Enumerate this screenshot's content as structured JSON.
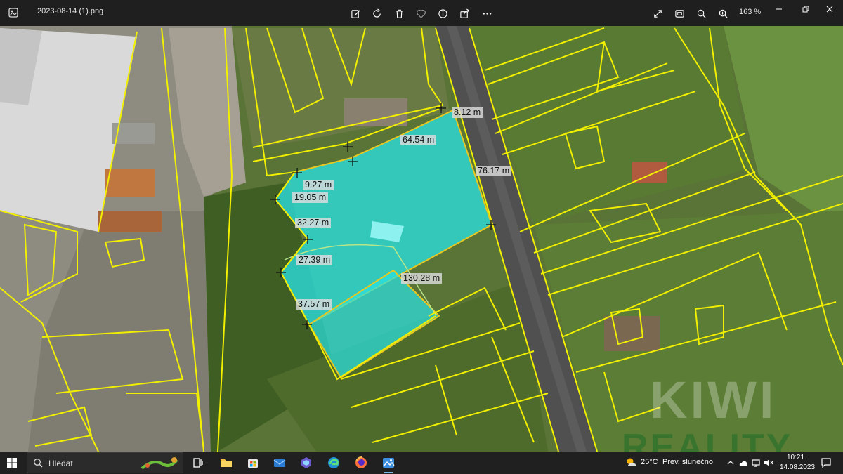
{
  "window": {
    "filename": "2023-08-14 (1).png",
    "zoom": "163 %"
  },
  "toolbar": {
    "items": [
      "edit-icon",
      "rotate-icon",
      "delete-icon",
      "favorite-icon",
      "info-icon",
      "share-icon",
      "more-icon"
    ]
  },
  "map": {
    "measurements": [
      "8.12 m",
      "64.54 m",
      "76.17 m",
      "9.27 m",
      "19.05 m",
      "32.27 m",
      "27.39 m",
      "130.28 m",
      "37.57 m"
    ],
    "colors": {
      "parcel_lines": "#f2f000",
      "plot_fill": "#29e0e0",
      "plot_outline": "#e8c820"
    }
  },
  "watermark": {
    "line1": "KIWI",
    "line2": "REALITY"
  },
  "taskbar": {
    "search_placeholder": "Hledat",
    "weather_temp": "25°C",
    "weather_desc": "Prev. slunečno",
    "time": "10:21",
    "date": "14.08.2023"
  }
}
